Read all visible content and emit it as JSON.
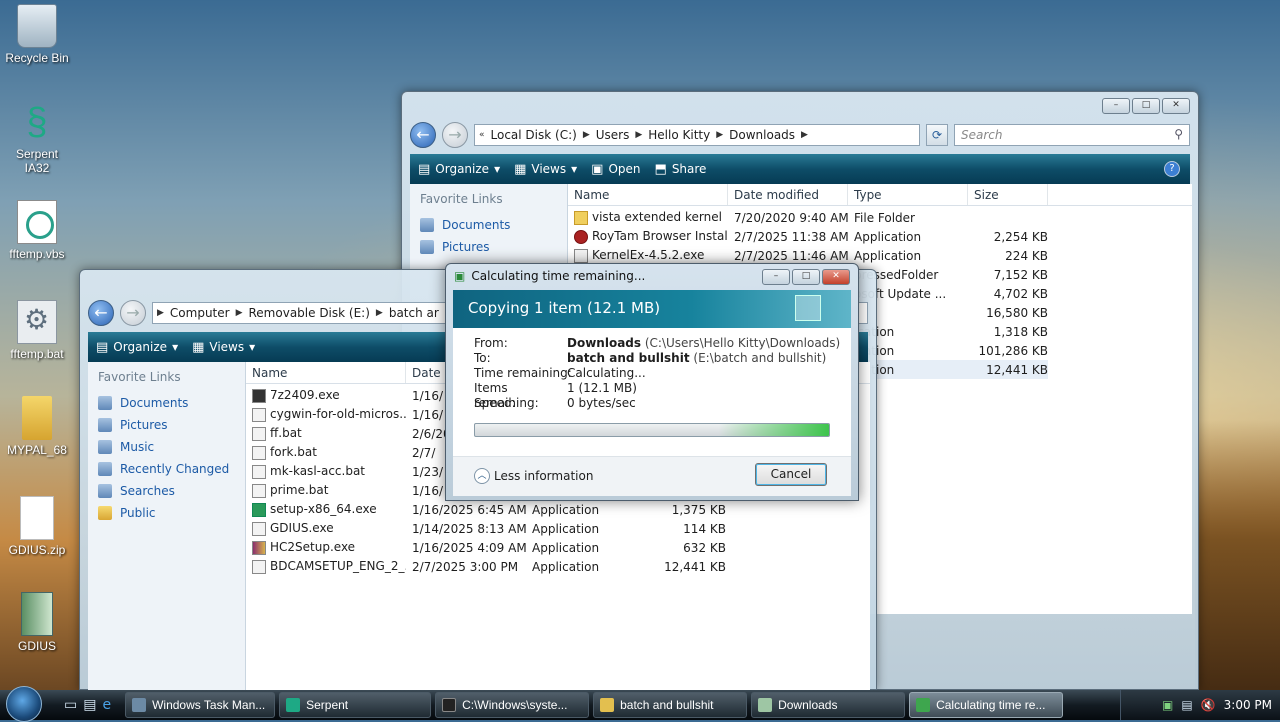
{
  "desktop": {
    "icons": [
      {
        "label": "Recycle Bin",
        "icon": "recycle-bin-icon"
      },
      {
        "label": "Serpent IA32",
        "icon": "serpent-icon"
      },
      {
        "label": "fftemp.vbs",
        "icon": "script-file-icon"
      },
      {
        "label": "fftemp.bat",
        "icon": "batch-file-icon"
      },
      {
        "label": "MYPAL_68",
        "icon": "folder-icon"
      },
      {
        "label": "GDIUS.zip",
        "icon": "zip-file-icon"
      },
      {
        "label": "GDIUS",
        "icon": "folder-icon"
      }
    ]
  },
  "downloads_window": {
    "breadcrumb": [
      "Local Disk (C:)",
      "Users",
      "Hello Kitty",
      "Downloads"
    ],
    "search_placeholder": "Search",
    "toolbar": {
      "organize": "Organize",
      "views": "Views",
      "open": "Open",
      "share": "Share"
    },
    "nav_title": "Favorite Links",
    "nav_items": [
      "Documents",
      "Pictures"
    ],
    "columns": [
      "Name",
      "Date modified",
      "Type",
      "Size"
    ],
    "rows": [
      {
        "name": "vista extended kernel",
        "date": "7/20/2020 9:40 AM",
        "type": "File Folder",
        "size": ""
      },
      {
        "name": "RoyTam Browser Instal...",
        "date": "2/7/2025 11:38 AM",
        "type": "Application",
        "size": "2,254 KB"
      },
      {
        "name": "KernelEx-4.5.2.exe",
        "date": "2/7/2025 11:46 AM",
        "type": "Application",
        "size": "224 KB"
      },
      {
        "name": "",
        "date": "",
        "type": "pressedFolder",
        "size": "7,152 KB"
      },
      {
        "name": "",
        "date": "",
        "type": "osoft Update ...",
        "size": "4,702 KB"
      },
      {
        "name": "",
        "date": "",
        "type": "le",
        "size": "16,580 KB"
      },
      {
        "name": "",
        "date": "",
        "type": "ication",
        "size": "1,318 KB"
      },
      {
        "name": "",
        "date": "",
        "type": "ication",
        "size": "101,286 KB"
      },
      {
        "name": "",
        "date": "",
        "type": "ication",
        "size": "12,441 KB"
      }
    ]
  },
  "batch_window": {
    "breadcrumb": [
      "Computer",
      "Removable Disk (E:)",
      "batch ar"
    ],
    "toolbar": {
      "organize": "Organize",
      "views": "Views"
    },
    "nav_title": "Favorite Links",
    "nav_items": [
      "Documents",
      "Pictures",
      "Music",
      "Recently Changed",
      "Searches",
      "Public"
    ],
    "columns": [
      "Name",
      "Date r"
    ],
    "rows": [
      {
        "name": "7z2409.exe",
        "date": "1/16/",
        "type": "",
        "size": ""
      },
      {
        "name": "cygwin-for-old-micros...",
        "date": "1/16/",
        "type": "",
        "size": ""
      },
      {
        "name": "ff.bat",
        "date": "2/6/20",
        "type": "",
        "size": ""
      },
      {
        "name": "fork.bat",
        "date": "2/7/",
        "type": "",
        "size": ""
      },
      {
        "name": "mk-kasl-acc.bat",
        "date": "1/23/",
        "type": "",
        "size": ""
      },
      {
        "name": "prime.bat",
        "date": "1/16/",
        "type": "",
        "size": ""
      },
      {
        "name": "setup-x86_64.exe",
        "date": "1/16/2025 6:45 AM",
        "type": "Application",
        "size": "1,375 KB"
      },
      {
        "name": "GDIUS.exe",
        "date": "1/14/2025 8:13 AM",
        "type": "Application",
        "size": "114 KB"
      },
      {
        "name": "HC2Setup.exe",
        "date": "1/16/2025 4:09 AM",
        "type": "Application",
        "size": "632 KB"
      },
      {
        "name": "BDCAMSETUP_ENG_2_...",
        "date": "2/7/2025 3:00 PM",
        "type": "Application",
        "size": "12,441 KB"
      }
    ]
  },
  "copy_dialog": {
    "title": "Calculating time remaining...",
    "heading": "Copying 1 item (12.1 MB)",
    "from_label": "From:",
    "from_bold": "Downloads",
    "from_path": "(C:\\Users\\Hello Kitty\\Downloads)",
    "to_label": "To:",
    "to_bold": "batch and bullshit",
    "to_path": "(E:\\batch and bullshit)",
    "time_label": "Time remaining:",
    "time_value": "Calculating...",
    "items_label": "Items remaining:",
    "items_value": "1 (12.1 MB)",
    "speed_label": "Speed:",
    "speed_value": "0 bytes/sec",
    "less_info": "Less information",
    "cancel": "Cancel"
  },
  "taskbar": {
    "buttons": [
      {
        "label": "Windows Task Man..."
      },
      {
        "label": "Serpent"
      },
      {
        "label": "C:\\Windows\\syste..."
      },
      {
        "label": "batch and bullshit"
      },
      {
        "label": "Downloads"
      },
      {
        "label": "Calculating time re..."
      }
    ],
    "clock": "3:00 PM"
  }
}
